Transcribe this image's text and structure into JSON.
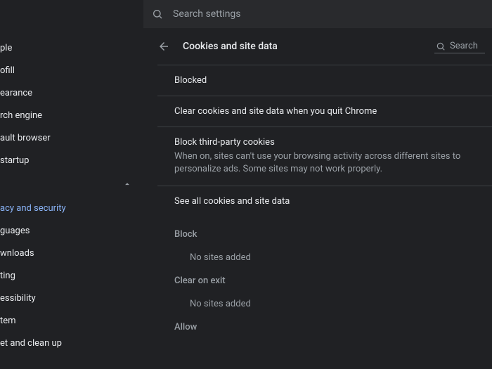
{
  "topbar": {
    "search_placeholder": "Search settings"
  },
  "sidebar": {
    "items": [
      "ple",
      "ofill",
      "earance",
      "rch engine",
      "ault browser",
      "startup",
      "acy and security",
      "guages",
      "wnloads",
      "ting",
      "essibility",
      "tem",
      "et and clean up"
    ]
  },
  "page": {
    "title": "Cookies and site data",
    "search_label": "Search"
  },
  "rows": {
    "blocked": "Blocked",
    "clear_on_quit": "Clear cookies and site data when you quit Chrome",
    "third_title": "Block third-party cookies",
    "third_sub": "When on, sites can't use your browsing activity across different sites to personalize ads. Some sites may not work properly.",
    "see_all": "See all cookies and site data"
  },
  "lists": {
    "block_label": "Block",
    "block_empty": "No sites added",
    "clear_label": "Clear on exit",
    "clear_empty": "No sites added",
    "allow_label": "Allow"
  }
}
